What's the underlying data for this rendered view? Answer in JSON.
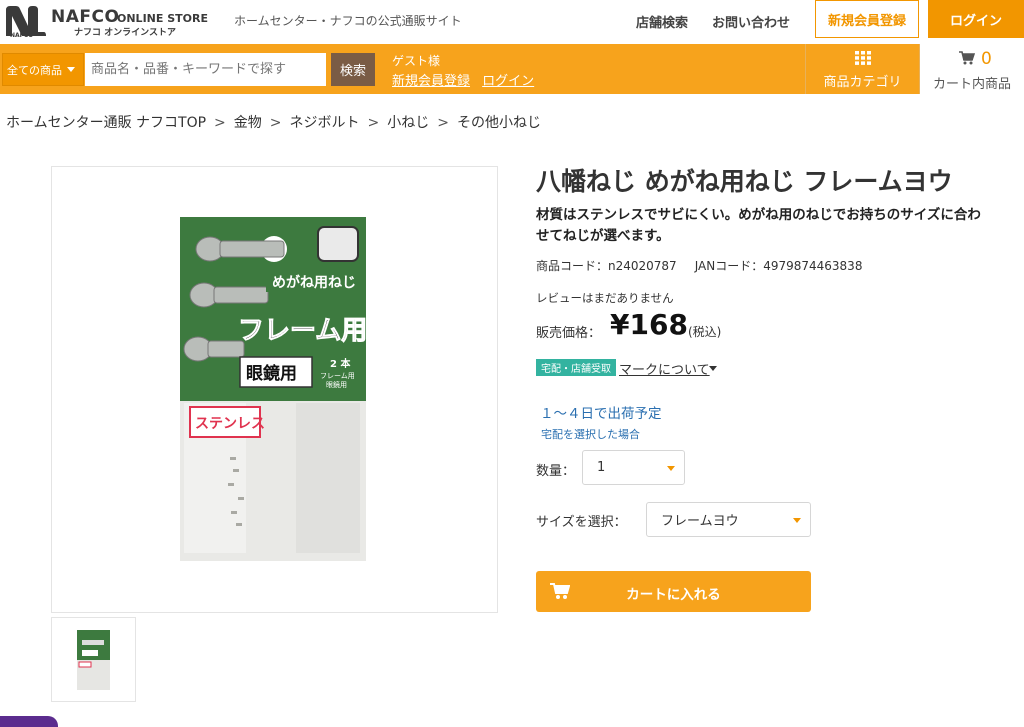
{
  "header": {
    "logo_text": "NAFCO",
    "logo_store": "ONLINE STORE",
    "logo_kana": "ナフコ オンラインストア",
    "tagline": "ホームセンター・ナフコの公式通販サイト",
    "store_search": "店舗検索",
    "contact": "お問い合わせ",
    "register": "新規会員登録",
    "login": "ログイン"
  },
  "nav": {
    "category_select": "全ての商品",
    "search_placeholder": "商品名・品番・キーワードで探す",
    "search_button": "検索",
    "guest": "ゲスト様",
    "guest_register": "新規会員登録",
    "guest_login": "ログイン",
    "category_menu": "商品カテゴリ",
    "cart_count": "0",
    "cart_label": "カート内商品"
  },
  "breadcrumb": [
    "ホームセンター通販 ナフコTOP",
    "金物",
    "ネジボルト",
    "小ねじ",
    "その他小ねじ"
  ],
  "package": {
    "title": "めがね用ねじ",
    "main": "フレーム用",
    "count": "2 本",
    "sub1": "フレーム用",
    "sub2": "眼鏡用",
    "label": "眼鏡用",
    "material": "ステンレス"
  },
  "product": {
    "title": "八幡ねじ めがね用ねじ フレームヨウ",
    "description": "材質はステンレスでサビにくい。めがね用のねじでお持ちのサイズに合わせてねじが選べます。",
    "code": "商品コード：n24020787",
    "jan": "JANコード：4979874463838",
    "review": "レビューはまだありません",
    "price_label": "販売価格：",
    "price": "¥168",
    "tax": "(税込)",
    "badge": "宅配・店舗受取",
    "mark_link": "マークについて",
    "shipping": "１～４日で出荷予定",
    "shipping_note": "宅配を選択した場合",
    "qty_label": "数量：",
    "qty_value": "1",
    "size_label": "サイズを選択：",
    "size_value": "フレームヨウ",
    "cart_button": "カートに入れる"
  },
  "colors": {
    "accent": "#f7a31c",
    "accent_dark": "#f29600",
    "search_button": "#7a5c45",
    "badge": "#33b3a0",
    "link_blue": "#2a6fb0"
  },
  "icons": [
    "logo-icon",
    "grid-icon",
    "cart-icon",
    "chevron-down-icon"
  ]
}
